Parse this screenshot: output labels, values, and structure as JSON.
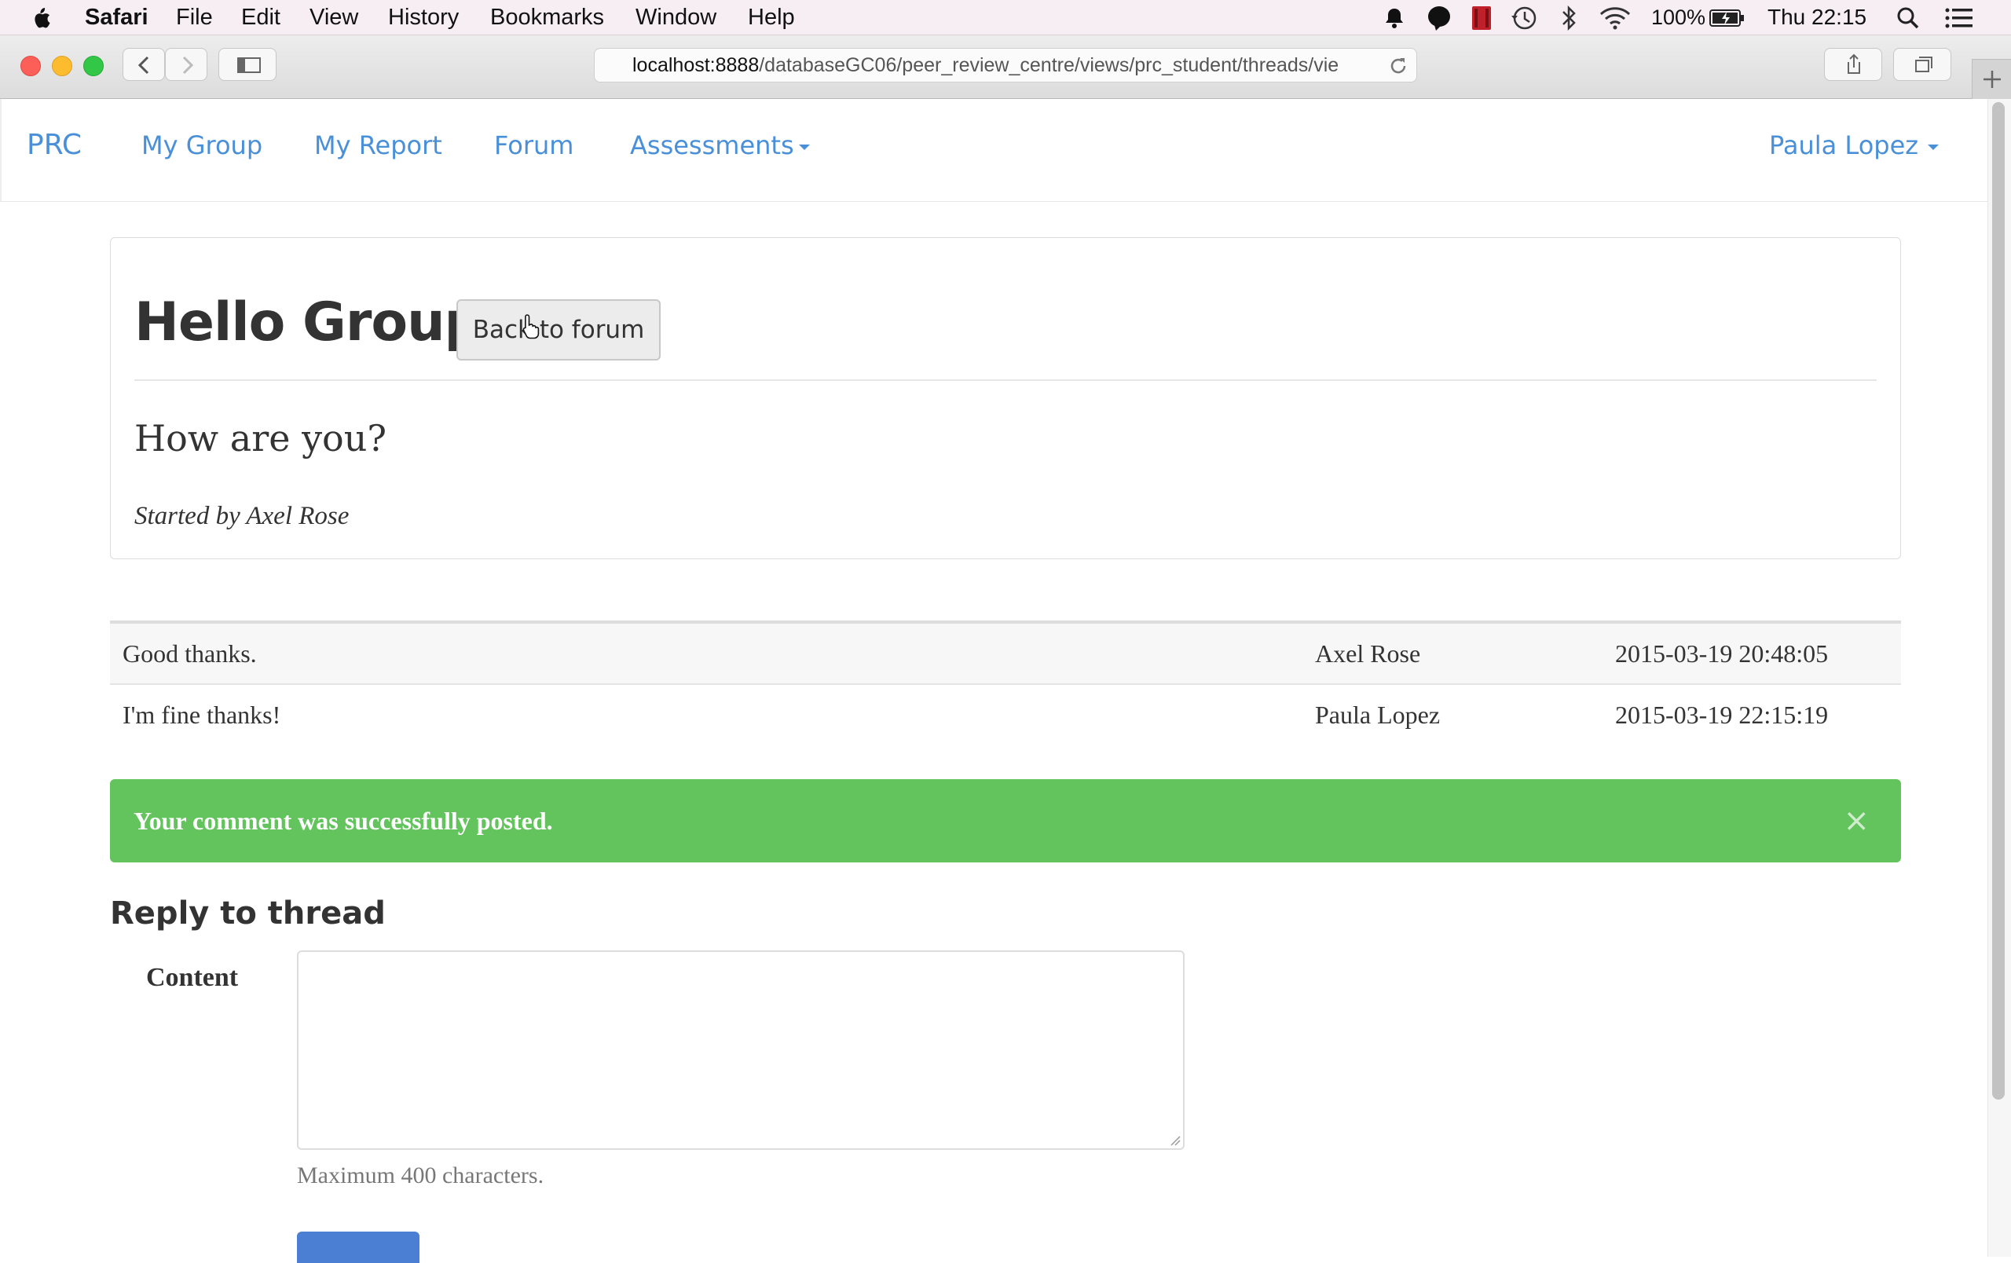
{
  "menubar": {
    "app_name": "Safari",
    "menus": [
      "File",
      "Edit",
      "View",
      "History",
      "Bookmarks",
      "Window",
      "Help"
    ],
    "battery": "100%",
    "clock": "Thu 22:15"
  },
  "browser": {
    "url_host": "localhost:8888",
    "url_path": "/databaseGC06/peer_review_centre/views/prc_student/threads/vie"
  },
  "navbar": {
    "brand": "PRC",
    "links": [
      "My Group",
      "My Report",
      "Forum",
      "Assessments"
    ],
    "user": "Paula Lopez"
  },
  "thread": {
    "title": "Hello Group",
    "back_button": "Back to forum",
    "question": "How are you?",
    "started_by": "Started by Axel Rose"
  },
  "comments": [
    {
      "text": "Good thanks.",
      "author": "Axel Rose",
      "date": "2015-03-19 20:48:05"
    },
    {
      "text": "I'm fine thanks!",
      "author": "Paula Lopez",
      "date": "2015-03-19 22:15:19"
    }
  ],
  "alert": {
    "message": "Your comment was successfully posted.",
    "close": "×",
    "color": "#63c35d"
  },
  "reply": {
    "heading": "Reply to thread",
    "content_label": "Content",
    "help_text": "Maximum 400 characters."
  },
  "colors": {
    "link": "#4a90d9",
    "primary_button": "#4a7fd3"
  }
}
